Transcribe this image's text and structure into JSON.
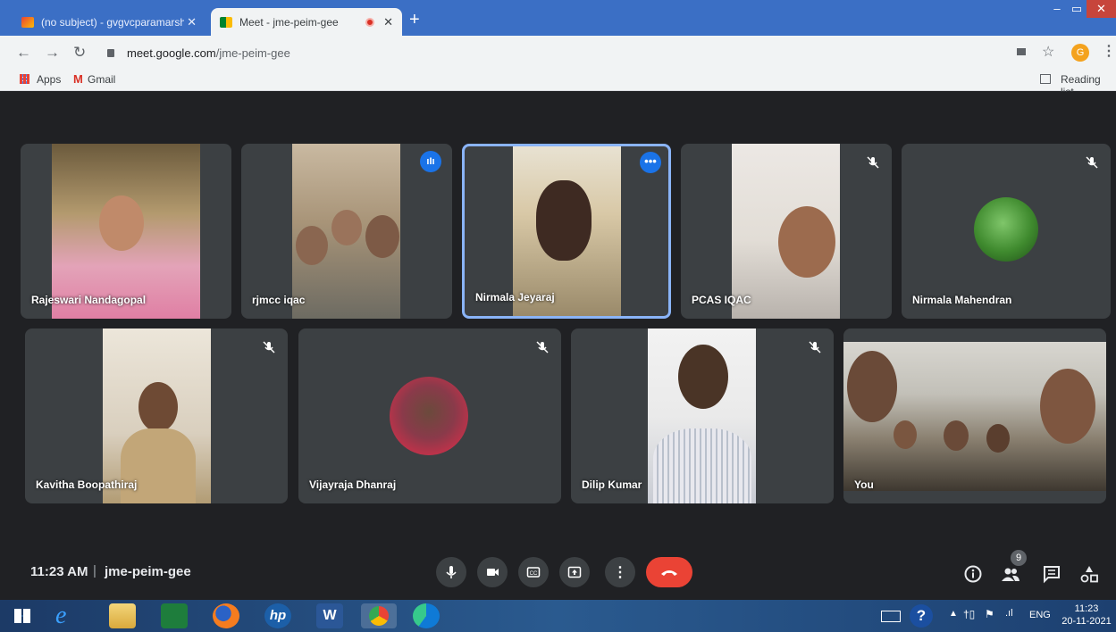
{
  "browser": {
    "tabs": [
      {
        "title": "(no subject) - gvgvcparamarsh@",
        "active": false
      },
      {
        "title": "Meet - jme-peim-gee",
        "active": true
      }
    ],
    "url_host": "meet.google.com",
    "url_path": "/jme-peim-gee",
    "profile_initial": "G",
    "bookmarks": {
      "apps": "Apps",
      "gmail": "Gmail",
      "reading_list": "Reading list"
    }
  },
  "meet": {
    "participants": [
      {
        "name": "Rajeswari Nandagopal"
      },
      {
        "name": "rjmcc iqac"
      },
      {
        "name": "Nirmala Jeyaraj"
      },
      {
        "name": "PCAS IQAC"
      },
      {
        "name": "Nirmala Mahendran"
      },
      {
        "name": "Kavitha Boopathiraj"
      },
      {
        "name": "Vijayraja Dhanraj"
      },
      {
        "name": "Dilip Kumar"
      },
      {
        "name": "You"
      }
    ],
    "time": "11:23 AM",
    "meeting_code": "jme-peim-gee",
    "people_count": "9",
    "colors": {
      "end_call": "#ea4335",
      "active_speaker": "#8ab4f8",
      "accent": "#1a73e8"
    }
  },
  "taskbar": {
    "language": "ENG",
    "time": "11:23",
    "date": "20-11-2021"
  }
}
